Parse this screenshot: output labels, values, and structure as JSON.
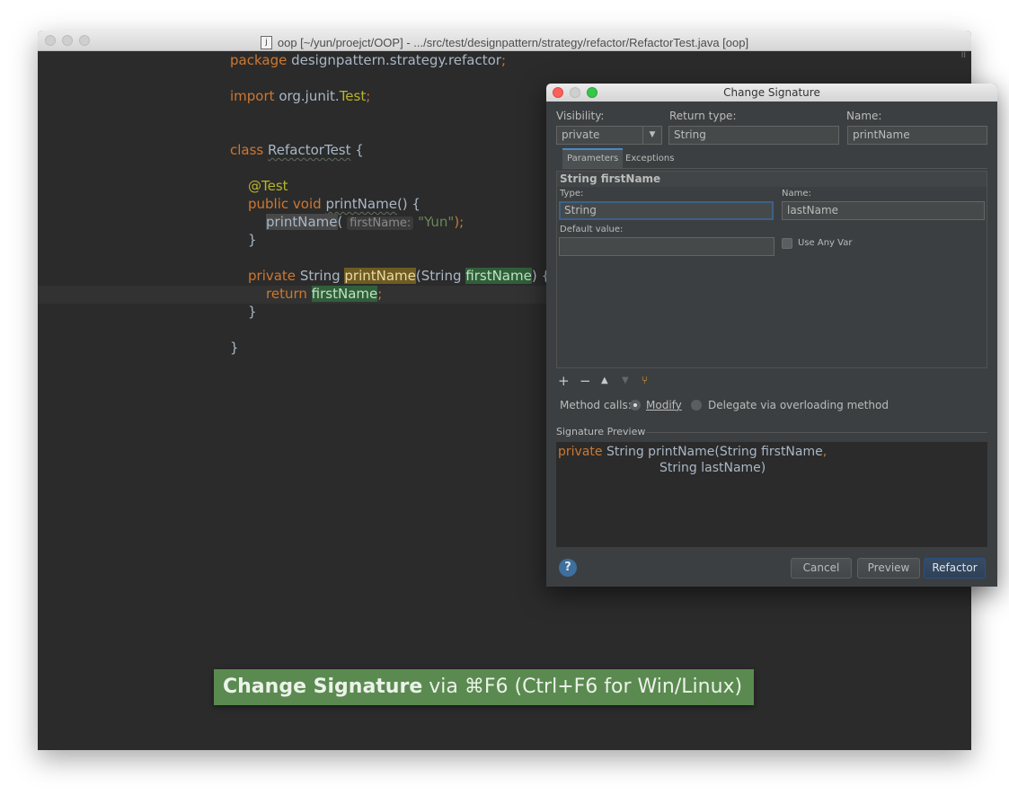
{
  "window": {
    "title": "oop [~/yun/proejct/OOP] - .../src/test/designpattern/strategy/refactor/RefactorTest.java [oop]",
    "file_icon_letter": "j",
    "pause_mark": "II"
  },
  "code": {
    "package_kw": "package",
    "package_name": "designpattern.strategy.refactor",
    "semicolon": ";",
    "import_kw": "import",
    "import_pkg": "org.junit.",
    "import_cls": "Test",
    "class_kw": "class",
    "class_name": "RefactorTest",
    "open_brace": "{",
    "close_brace": "}",
    "annotation": "@Test",
    "public_void": "public void",
    "method_name": "printName",
    "parens_open": "() {",
    "call_name": "printName",
    "call_open": "(",
    "hint_label": "firstName:",
    "call_arg": "\"Yun\"",
    "call_close": ");",
    "private_kw": "private",
    "string_type": "String",
    "param_open": "(String ",
    "param_name": "firstName",
    "param_close": ") {",
    "return_kw": "return",
    "return_var": "firstName"
  },
  "caption": {
    "bold": "Change Signature",
    "rest": "via ⌘F6 (Ctrl+F6 for Win/Linux)"
  },
  "dialog": {
    "title": "Change Signature",
    "visibility_label": "Visibility:",
    "visibility_value": "private",
    "return_type_label": "Return type:",
    "return_type_value": "String",
    "name_label": "Name:",
    "name_value": "printName",
    "tabs": [
      "Parameters",
      "Exceptions"
    ],
    "param_header": "String firstName",
    "type_label": "Type:",
    "type_value": "String",
    "param_name_label": "Name:",
    "param_name_value": "lastName",
    "default_value_label": "Default value:",
    "default_value": "",
    "use_any_var_label": "Use Any Var",
    "toolbar_icons": [
      "plus-icon",
      "minus-icon",
      "move-up-icon",
      "move-down-icon",
      "propagate-icon"
    ],
    "method_calls_label": "Method calls:",
    "method_calls_options": [
      "Modify",
      "Delegate via overloading method"
    ],
    "method_calls_selected": "Modify",
    "signature_preview_label": "Signature Preview",
    "preview_line1_kw": "private",
    "preview_line1_rest": "String printName(String firstName",
    "preview_line1_comma": ",",
    "preview_line2": "String lastName)",
    "help_symbol": "?",
    "buttons": {
      "cancel": "Cancel",
      "preview": "Preview",
      "refactor": "Refactor"
    }
  }
}
